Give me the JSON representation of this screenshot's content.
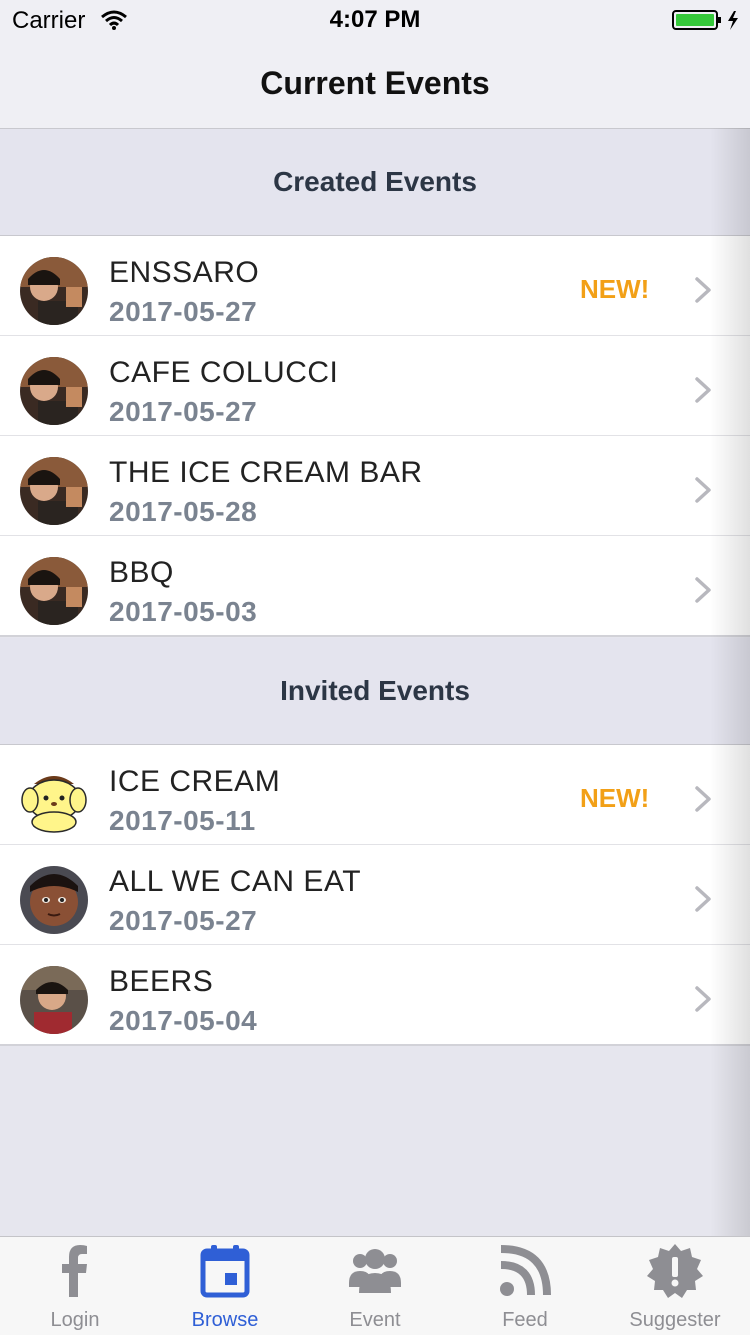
{
  "status_bar": {
    "carrier": "Carrier",
    "time": "4:07 PM"
  },
  "nav": {
    "title": "Current Events"
  },
  "sections": {
    "created": {
      "title": "Created Events",
      "rows": [
        {
          "title": "ENSSARO",
          "date": "2017-05-27",
          "badge": "NEW!"
        },
        {
          "title": "CAFE COLUCCI",
          "date": "2017-05-27",
          "badge": ""
        },
        {
          "title": "THE ICE CREAM BAR",
          "date": "2017-05-28",
          "badge": ""
        },
        {
          "title": "BBQ",
          "date": "2017-05-03",
          "badge": ""
        }
      ]
    },
    "invited": {
      "title": "Invited Events",
      "rows": [
        {
          "title": "ICE CREAM",
          "date": "2017-05-11",
          "badge": "NEW!"
        },
        {
          "title": "ALL WE CAN EAT",
          "date": "2017-05-27",
          "badge": ""
        },
        {
          "title": "BEERS",
          "date": "2017-05-04",
          "badge": ""
        }
      ]
    }
  },
  "tabs": [
    {
      "label": "Login",
      "icon": "facebook-icon"
    },
    {
      "label": "Browse",
      "icon": "calendar-icon",
      "active": true
    },
    {
      "label": "Event",
      "icon": "group-icon"
    },
    {
      "label": "Feed",
      "icon": "rss-icon"
    },
    {
      "label": "Suggester",
      "icon": "alert-badge-icon"
    }
  ],
  "colors": {
    "accent": "#2f5fd6",
    "badge": "#f2a017",
    "date": "#7a8390"
  }
}
